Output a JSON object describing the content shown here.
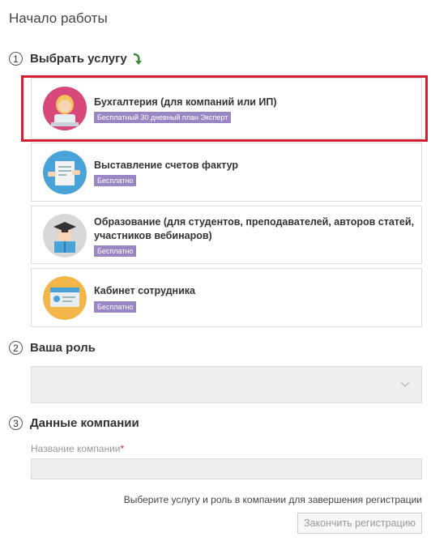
{
  "page": {
    "title": "Начало работы"
  },
  "steps": [
    {
      "number": "1",
      "title": "Выбрать услугу"
    },
    {
      "number": "2",
      "title": "Ваша роль"
    },
    {
      "number": "3",
      "title": "Данные компании"
    }
  ],
  "services": [
    {
      "title": "Бухгалтерия (для компаний или ИП)",
      "badge": "Бесплатный 30 дневный план Эксперт",
      "icon": "accountant-avatar-icon",
      "selected": true
    },
    {
      "title": "Выставление счетов фактур",
      "badge": "Бесплатно",
      "icon": "invoice-icon",
      "selected": false
    },
    {
      "title_line1": "Образование (для студентов, преподавателей, авторов статей,",
      "title_line2": "участников вебинаров)",
      "badge": "Бесплатно",
      "icon": "graduate-icon",
      "selected": false
    },
    {
      "title": "Кабинет сотрудника",
      "badge": "Бесплатно",
      "icon": "employee-card-icon",
      "selected": false
    }
  ],
  "role": {
    "value": ""
  },
  "company": {
    "label": "Название компании",
    "required_mark": "*",
    "value": ""
  },
  "footer": {
    "hint": "Выберите услугу и роль в компании для завершения регистрации",
    "finish_label": "Закончить регистрацию"
  },
  "colors": {
    "accent": "#d32030",
    "badge": "#9a86c2",
    "arrow": "#3a8a3a"
  }
}
